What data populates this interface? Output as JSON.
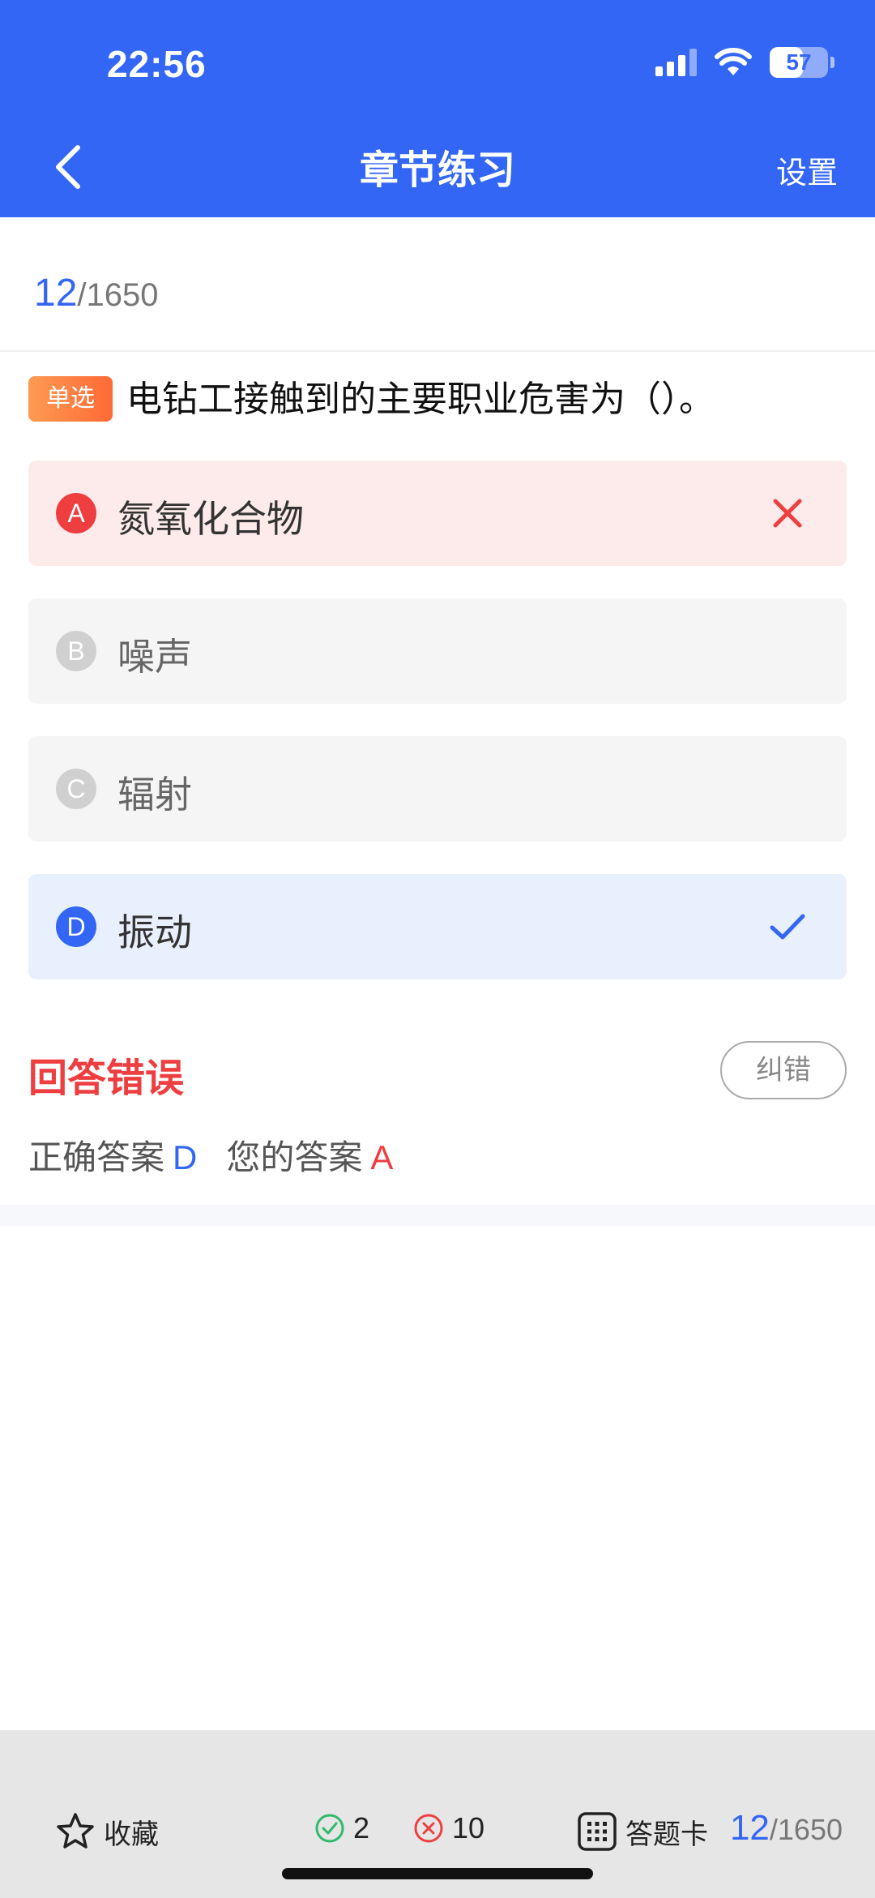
{
  "status_bar": {
    "time": "22:56",
    "battery": "57",
    "battery_level_percent": 57,
    "icons": [
      "cellular-signal-icon",
      "wifi-icon",
      "battery-icon"
    ]
  },
  "nav": {
    "title": "章节练习",
    "back_icon": "chevron-left-icon",
    "settings_label": "设置"
  },
  "progress": {
    "current": "12",
    "total": "/1650"
  },
  "question": {
    "type_tag": "单选",
    "text": "电钻工接触到的主要职业危害为（）。",
    "options": [
      {
        "letter": "A",
        "text": "氮氧化合物",
        "state": "wrong"
      },
      {
        "letter": "B",
        "text": "噪声",
        "state": "neutral"
      },
      {
        "letter": "C",
        "text": "辐射",
        "state": "neutral"
      },
      {
        "letter": "D",
        "text": "振动",
        "state": "correct"
      }
    ]
  },
  "result": {
    "title": "回答错误",
    "report_error_label": "纠错",
    "correct_answer_label": "正确答案",
    "correct_answer_value": "D",
    "your_answer_label": "您的答案",
    "your_answer_value": "A"
  },
  "bottom_bar": {
    "favorite_label": "收藏",
    "correct_count": "2",
    "wrong_count": "10",
    "answer_card_label": "答题卡",
    "progress_current": "12",
    "progress_total": "/1650"
  },
  "colors": {
    "primary": "#3366f5",
    "error": "#ee3e40",
    "success": "#2dbb6a",
    "tag_orange": "#ff7a3d"
  }
}
